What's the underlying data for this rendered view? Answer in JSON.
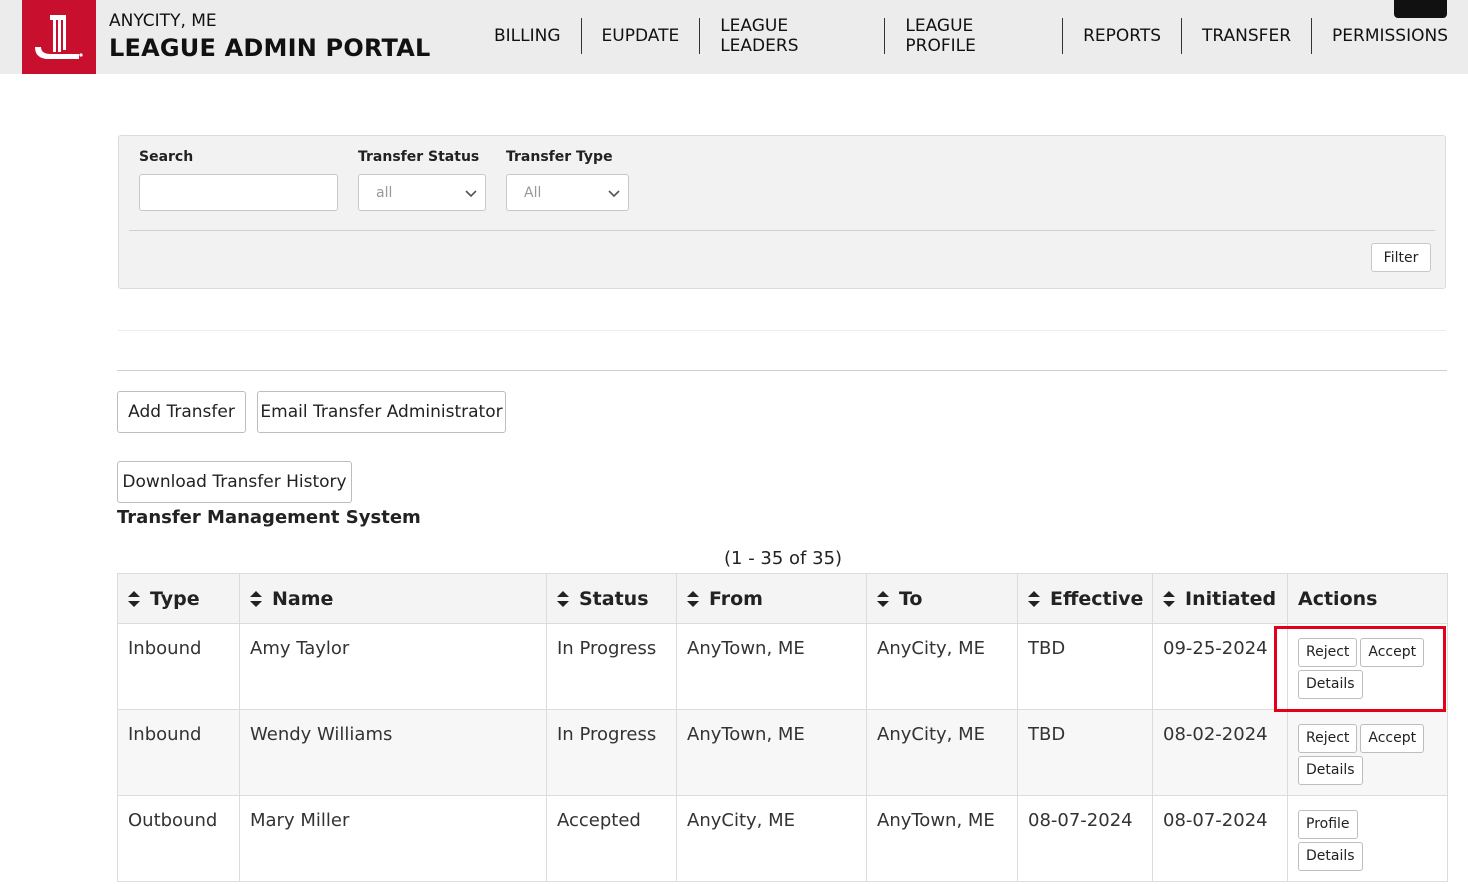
{
  "header": {
    "city": "ANYCITY, ME",
    "portal_title": "LEAGUE ADMIN PORTAL",
    "brand_color": "#c8102e",
    "nav": [
      {
        "label": "BILLING"
      },
      {
        "label": "EUPDATE"
      },
      {
        "label": "LEAGUE LEADERS"
      },
      {
        "label": "LEAGUE PROFILE"
      },
      {
        "label": "REPORTS"
      },
      {
        "label": "TRANSFER"
      },
      {
        "label": "PERMISSIONS"
      }
    ]
  },
  "filters": {
    "search_label": "Search",
    "search_value": "",
    "status_label": "Transfer Status",
    "status_value": "all",
    "type_label": "Transfer Type",
    "type_value": "All",
    "filter_button": "Filter"
  },
  "actions": {
    "add_transfer": "Add Transfer",
    "email_admin": "Email Transfer Administrator",
    "download_history": "Download Transfer History"
  },
  "section_title": "Transfer Management System",
  "pagination_text": "(1 - 35 of 35)",
  "table": {
    "columns": [
      "Type",
      "Name",
      "Status",
      "From",
      "To",
      "Effective",
      "Initiated",
      "Actions"
    ],
    "rows": [
      {
        "type": "Inbound",
        "name": "Amy Taylor",
        "status": "In Progress",
        "from": "AnyTown, ME",
        "to": "AnyCity, ME",
        "effective": "TBD",
        "initiated": "09-25-2024",
        "buttons": [
          "Reject",
          "Accept",
          "Details"
        ]
      },
      {
        "type": "Inbound",
        "name": "Wendy Williams",
        "status": "In Progress",
        "from": "AnyTown, ME",
        "to": "AnyCity, ME",
        "effective": "TBD",
        "initiated": "08-02-2024",
        "buttons": [
          "Reject",
          "Accept",
          "Details"
        ]
      },
      {
        "type": "Outbound",
        "name": "Mary Miller",
        "status": "Accepted",
        "from": "AnyCity, ME",
        "to": "AnyTown, ME",
        "effective": "08-07-2024",
        "initiated": "08-07-2024",
        "buttons": [
          "Profile",
          "Details"
        ]
      }
    ]
  },
  "highlight_color": "#e4001b"
}
